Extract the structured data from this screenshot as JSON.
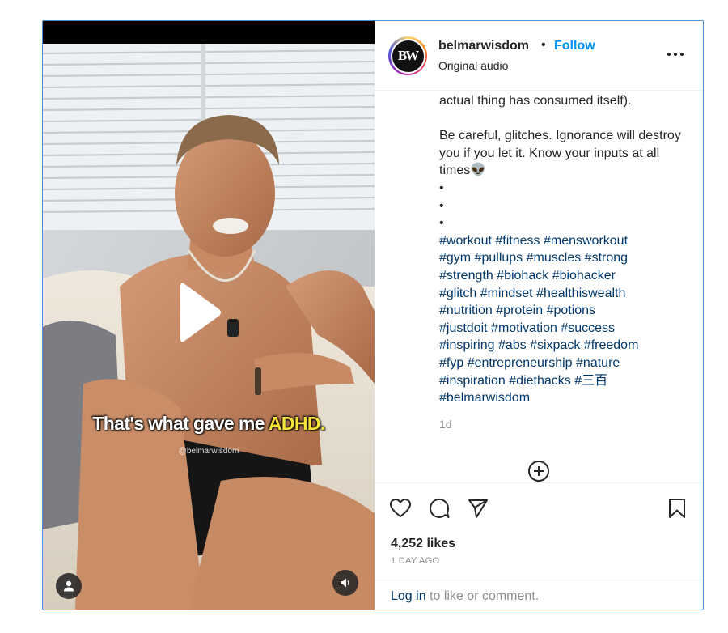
{
  "video": {
    "caption_main": "That's what gave me ",
    "caption_highlight": "ADHD.",
    "watermark": "@belmarwisdom"
  },
  "header": {
    "avatar_text": "BW",
    "username": "belmarwisdom",
    "separator": "•",
    "follow_label": "Follow",
    "audio_label": "Original audio"
  },
  "caption": {
    "line_top": "actual thing has consumed itself).",
    "paragraph": "Be careful, glitches. Ignorance will destroy you if you let it. Know your inputs at all times👽",
    "dots": [
      "•",
      "•",
      "•"
    ],
    "hashtags": [
      [
        "#workout",
        "#fitness",
        "#mensworkout"
      ],
      [
        "#gym",
        "#pullups",
        "#muscles",
        "#strong"
      ],
      [
        "#strength",
        "#biohack",
        "#biohacker"
      ],
      [
        "#glitch",
        "#mindset",
        "#healthiswealth"
      ],
      [
        "#nutrition",
        "#protein",
        "#potions"
      ],
      [
        "#justdoit",
        "#motivation",
        "#success"
      ],
      [
        "#inspiring",
        "#abs",
        "#sixpack",
        "#freedom"
      ],
      [
        "#fyp",
        "#entrepreneurship",
        "#nature"
      ],
      [
        "#inspiration",
        "#diethacks",
        "#三百"
      ],
      [
        "#belmarwisdom"
      ]
    ],
    "time_ago": "1d"
  },
  "actions": {
    "likes": "4,252 likes",
    "date": "1 DAY AGO",
    "login_link": "Log in",
    "login_rest": " to like or comment."
  },
  "colors": {
    "accent": "#0095f6",
    "hashtag": "#00376b",
    "muted": "#8e8e8e",
    "border": "#efefef",
    "caption_highlight": "#f5e23a"
  },
  "icons": [
    "play-icon",
    "user-icon",
    "volume-icon",
    "more-icon",
    "add-icon",
    "heart-icon",
    "comment-icon",
    "share-icon",
    "bookmark-icon"
  ]
}
